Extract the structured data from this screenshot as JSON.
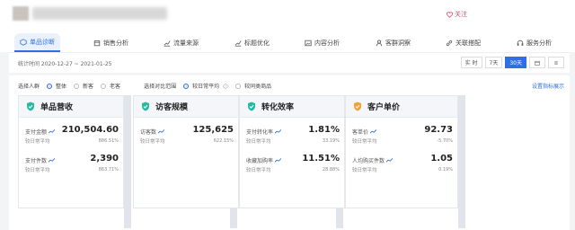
{
  "header": {
    "follow_label": "关注"
  },
  "tabs": [
    {
      "label": "单品诊断",
      "icon": "hexagon-icon",
      "active": true
    },
    {
      "label": "销售分析",
      "icon": "box-icon"
    },
    {
      "label": "流量来源",
      "icon": "chart-icon"
    },
    {
      "label": "标题优化",
      "icon": "chart-icon"
    },
    {
      "label": "内容分析",
      "icon": "image-icon"
    },
    {
      "label": "客群洞察",
      "icon": "user-icon"
    },
    {
      "label": "关联搭配",
      "icon": "link-icon"
    },
    {
      "label": "服务分析",
      "icon": "headset-icon"
    }
  ],
  "datebar": {
    "label": "统计时间 2020-12-27 ~ 2021-01-25",
    "buttons": [
      "实 时",
      "7天",
      "30天"
    ],
    "active_button": "30天"
  },
  "filters": {
    "crowd_label": "选择人群",
    "crowd_options": [
      "整体",
      "新客",
      "老客"
    ],
    "compare_label": "选择对比范围",
    "compare_options": [
      "较日常平均",
      "较同类商品"
    ],
    "setting_link": "设置指标展示"
  },
  "cards": [
    {
      "title": "单品营收",
      "icon_color": "#26b9a1",
      "metrics": [
        {
          "name": "支付金额",
          "value": "210,504.60",
          "sub": "较日常平均",
          "pct": "886.51%"
        },
        {
          "name": "支付件数",
          "value": "2,390",
          "sub": "较日常平均",
          "pct": "863.71%"
        }
      ]
    },
    {
      "title": "访客规模",
      "icon_color": "#26b9a1",
      "metrics": [
        {
          "name": "访客数",
          "value": "125,625",
          "sub": "较日常平均",
          "pct": "622.15%"
        }
      ]
    },
    {
      "title": "转化效率",
      "icon_color": "#26b9a1",
      "metrics": [
        {
          "name": "支付转化率",
          "value": "1.81%",
          "sub": "较日常平均",
          "pct": "33.19%"
        },
        {
          "name": "收藏加购率",
          "value": "11.51%",
          "sub": "较日常平均",
          "pct": "28.88%"
        }
      ]
    },
    {
      "title": "客户单价",
      "icon_color": "#f0a23a",
      "metrics": [
        {
          "name": "客单价",
          "value": "92.73",
          "sub": "较日常平均",
          "pct": "-5.70%"
        },
        {
          "name": "人均购买件数",
          "value": "1.05",
          "sub": "较日常平均",
          "pct": "0.19%"
        }
      ]
    }
  ]
}
